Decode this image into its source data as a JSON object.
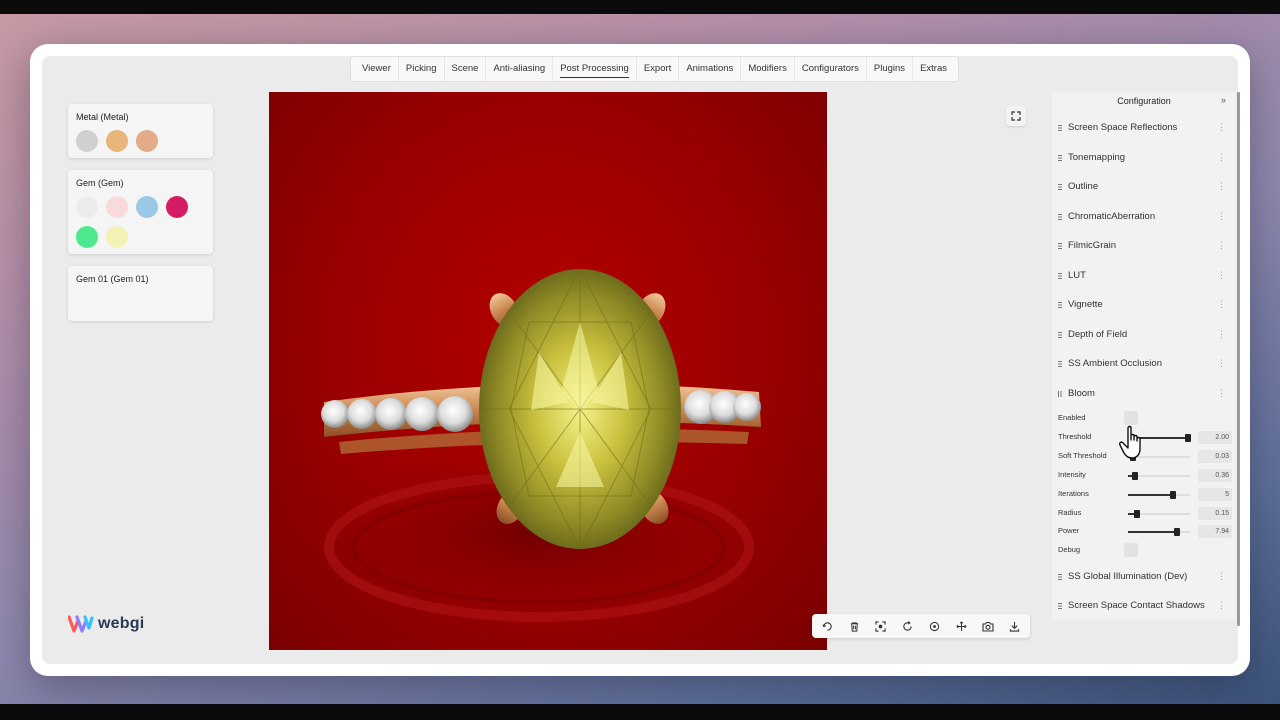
{
  "nav": {
    "items": [
      "Viewer",
      "Picking",
      "Scene",
      "Anti-aliasing",
      "Post Processing",
      "Export",
      "Animations",
      "Modifiers",
      "Configurators",
      "Plugins",
      "Extras"
    ],
    "active": "Post Processing"
  },
  "materials": [
    {
      "title": "Metal (Metal)",
      "swatches": [
        "#d0d0d0",
        "#e8b57a",
        "#e3ab88"
      ]
    },
    {
      "title": "Gem (Gem)",
      "swatches": [
        "#ececec",
        "#f8d9dc",
        "#9ac8e6",
        "#d41c62",
        "#4ee88f",
        "#f4f1b4"
      ]
    },
    {
      "title": "Gem 01 (Gem 01)",
      "swatches": []
    }
  ],
  "logo": {
    "text": "webgi"
  },
  "config": {
    "title": "Configuration",
    "collapse_icon": "double-chevron-right-icon",
    "sections_before": [
      "Screen Space Reflections",
      "Tonemapping",
      "Outline",
      "ChromaticAberration",
      "FilmicGrain",
      "LUT",
      "Vignette",
      "Depth of Field",
      "SS Ambient Occlusion"
    ],
    "bloom": {
      "label": "Bloom",
      "enabled_label": "Enabled",
      "params": [
        {
          "label": "Threshold",
          "value": "2.00",
          "fraction": 0.97
        },
        {
          "label": "Soft Threshold",
          "value": "0.03",
          "fraction": 0.08
        },
        {
          "label": "Intensity",
          "value": "0.36",
          "fraction": 0.11
        },
        {
          "label": "Iterations",
          "value": "5",
          "fraction": 0.72
        },
        {
          "label": "Radius",
          "value": "0.15",
          "fraction": 0.14
        },
        {
          "label": "Power",
          "value": "7.94",
          "fraction": 0.79
        }
      ],
      "debug_label": "Debug"
    },
    "sections_after": [
      "SS Global Illumination (Dev)",
      "Screen Space Contact Shadows"
    ]
  },
  "toolbar_icons": [
    "reset-view-icon",
    "trash-icon",
    "focus-icon",
    "rotate-icon",
    "target-icon",
    "move-icon",
    "camera-icon",
    "download-icon"
  ],
  "colors": {
    "viewport_bg": "#990000",
    "accent": "#222222"
  }
}
